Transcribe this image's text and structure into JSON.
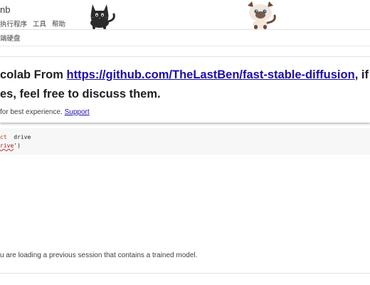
{
  "header": {
    "title_fragment": "nb",
    "menu": [
      "执行程序",
      "工具",
      "帮助"
    ],
    "toolbar_label": "端硬盘"
  },
  "text_cell": {
    "heading_line1_prefix": "colab From ",
    "heading_link": "https://github.com/TheLastBen/fast-stable-diffusion",
    "heading_line1_suffix": ", if",
    "heading_line2": "es, feel free to discuss them.",
    "note_prefix": "for best experience. ",
    "note_link": "Support"
  },
  "code_cell": {
    "line1_keyword": "ct",
    "line1_rest": "  drive",
    "line2_string": "rive",
    "line2_rest": "')"
  },
  "bottom_note": "u are loading a previous session that contains a trained model.",
  "icons": {
    "black_cat": "black-cat-sticker",
    "siamese_cat": "siamese-cat-sticker"
  },
  "colors": {
    "link": "#1a0dab",
    "code_background": "#f7f7f7",
    "keyword": "#b7410e"
  }
}
